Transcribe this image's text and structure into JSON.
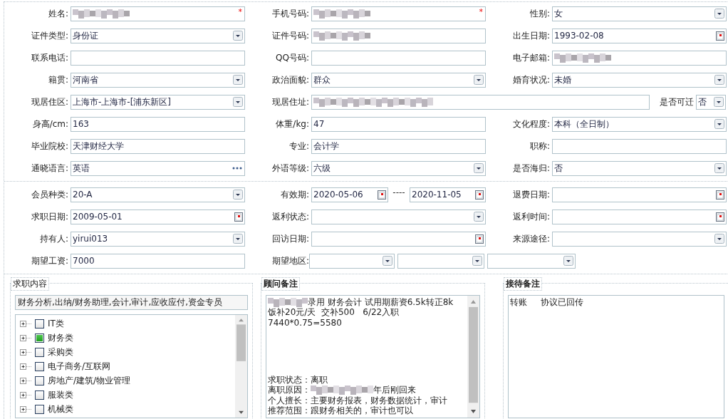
{
  "basic_info": {
    "rows": [
      {
        "fields": [
          {
            "label": "姓名:",
            "kind": "text",
            "blurred": true,
            "required_mark": "*"
          },
          {
            "label": "手机号码:",
            "kind": "text",
            "blurred": true,
            "required_mark": "*"
          },
          {
            "label": "性别:",
            "kind": "select",
            "value": "女"
          }
        ]
      },
      {
        "fields": [
          {
            "label": "证件类型:",
            "kind": "select",
            "value": "身份证"
          },
          {
            "label": "证件号码:",
            "kind": "text",
            "blurred": true
          },
          {
            "label": "出生日期:",
            "kind": "date",
            "value": "1993-02-08"
          }
        ]
      },
      {
        "fields": [
          {
            "label": "联系电话:",
            "kind": "text"
          },
          {
            "label": "QQ号码:",
            "kind": "text"
          },
          {
            "label": "电子邮箱:",
            "kind": "text",
            "blurred": true
          }
        ]
      },
      {
        "fields": [
          {
            "label": "籍贯:",
            "kind": "select",
            "value": "河南省"
          },
          {
            "label": "政治面貌:",
            "kind": "select",
            "value": "群众"
          },
          {
            "label": "婚育状况:",
            "kind": "select",
            "value": "未婚"
          }
        ]
      },
      {
        "fields": [
          {
            "label": "现居住区:",
            "kind": "select",
            "value": "上海市-上海市-[浦东新区]"
          },
          {
            "label": "现居住址:",
            "kind": "wide",
            "blurred": true
          },
          {
            "label": "是否可迁",
            "kind": "mini-select",
            "value": "否"
          }
        ]
      },
      {
        "fields": [
          {
            "label": "身高/cm:",
            "kind": "text",
            "value": "163"
          },
          {
            "label": "体重/kg:",
            "kind": "text",
            "value": "47"
          },
          {
            "label": "文化程度:",
            "kind": "select",
            "value": "本科（全日制）"
          }
        ]
      },
      {
        "fields": [
          {
            "label": "毕业院校:",
            "kind": "text",
            "value": "天津财经大学"
          },
          {
            "label": "专业:",
            "kind": "text",
            "value": "会计学"
          },
          {
            "label": "职称:",
            "kind": "text"
          }
        ]
      },
      {
        "fields": [
          {
            "label": "通晓语言:",
            "kind": "lookup",
            "value": "英语"
          },
          {
            "label": "外语等级:",
            "kind": "select",
            "value": "六级"
          },
          {
            "label": "是否海归:",
            "kind": "select",
            "value": "否"
          }
        ]
      }
    ]
  },
  "membership": {
    "rows": [
      {
        "fields": [
          {
            "label": "会员种类:",
            "kind": "select",
            "value": "20-A"
          },
          {
            "label": "有效期:",
            "kind": "date-range",
            "from": "2020-05-06",
            "separator": "----",
            "to": "2020-11-05"
          },
          {
            "label": "退费日期:",
            "kind": "date"
          }
        ]
      },
      {
        "fields": [
          {
            "label": "求职日期:",
            "kind": "date",
            "value": "2009-05-01"
          },
          {
            "label": "返利状态:",
            "kind": "select"
          },
          {
            "label": "返利时间:",
            "kind": "date"
          }
        ]
      },
      {
        "fields": [
          {
            "label": "持有人:",
            "kind": "select",
            "value": "yirui013"
          },
          {
            "label": "回访日期:",
            "kind": "date"
          },
          {
            "label": "来源途径:",
            "kind": "select"
          }
        ]
      },
      {
        "fields": [
          {
            "label": "期望工资:",
            "kind": "text",
            "value": "7000"
          },
          {
            "label": "期望地区:",
            "kind": "region"
          }
        ]
      }
    ]
  },
  "job_content": {
    "legend": "求职内容",
    "summary": "财务分析,出纳/财务助理,会计,审计,应收应付,资金专员",
    "categories": [
      {
        "label": "IT类",
        "checked": false,
        "expanded": false
      },
      {
        "label": "财务类",
        "checked": true,
        "expanded": false
      },
      {
        "label": "采购类",
        "checked": false,
        "expanded": false
      },
      {
        "label": "电子商务/互联网",
        "checked": false,
        "expanded": false
      },
      {
        "label": "房地产/建筑/物业管理",
        "checked": false,
        "expanded": false
      },
      {
        "label": "服装类",
        "checked": false,
        "expanded": false
      },
      {
        "label": "机械类",
        "checked": false,
        "expanded": false
      }
    ]
  },
  "consultant_notes": {
    "legend": "顾问备注",
    "top_lines": [
      [
        {
          "kind": "blur"
        },
        {
          "kind": "text",
          "text": "录用 财务会计 试用期薪资6.5k转正8k"
        }
      ],
      [
        {
          "kind": "text",
          "text": "饭补20元/天  交补500   6/22入职"
        }
      ],
      [
        {
          "kind": "text",
          "text": "7440*0.75=5580"
        }
      ]
    ],
    "bottom_lines": [
      [
        {
          "kind": "text",
          "text": "求职状态：离职"
        }
      ],
      [
        {
          "kind": "text",
          "text": "离职原因："
        },
        {
          "kind": "blur"
        },
        {
          "kind": "text",
          "text": "年后刚回来"
        }
      ],
      [
        {
          "kind": "text",
          "text": "个人擅长：主要财务报表，财务数据统计，审计"
        }
      ],
      [
        {
          "kind": "text",
          "text": "推荐范围：跟财务相关的，审计也可以"
        }
      ]
    ]
  },
  "reception_notes": {
    "legend": "接待备注",
    "text": "转账     协议已回传"
  }
}
